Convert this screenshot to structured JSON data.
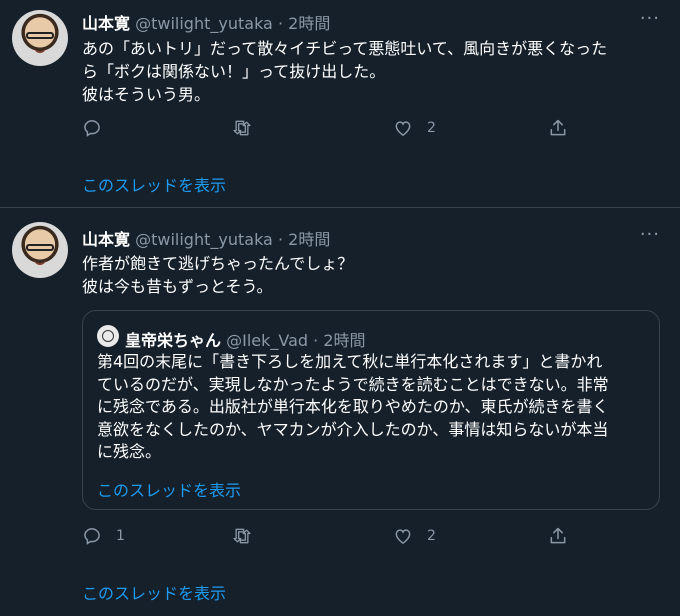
{
  "tweets": [
    {
      "name": "山本寛",
      "handle": "@twilight_yutaka",
      "dot": "·",
      "time": "2時間",
      "more": "···",
      "text": "あの「あいトリ」だって散々イチビって悪態吐いて、風向きが悪くなった\nら「ボクは関係ない！」って抜け出した。\n彼はそういう男。",
      "reply_count": "",
      "retweet_count": "",
      "like_count": "2",
      "thread_link": "このスレッドを表示"
    },
    {
      "name": "山本寛",
      "handle": "@twilight_yutaka",
      "dot": "·",
      "time": "2時間",
      "more": "···",
      "text": "作者が飽きて逃げちゃったんでしょ？\n彼は今も昔もずっとそう。",
      "quote": {
        "name": "皇帝栄ちゃん",
        "handle": "@Ilek_Vad",
        "dot": "·",
        "time": "2時間",
        "text": "第4回の末尾に「書き下ろしを加えて秋に単行本化されます」と書かれ\nているのだが、実現しなかったようで続きを読むことはできない。非常\nに残念である。出版社が単行本化を取りやめたのか、東氏が続きを書く\n意欲をなくしたのか、ヤマカンが介入したのか、事情は知らないが本当\nに残念。",
        "thread_link": "このスレッドを表示"
      },
      "reply_count": "1",
      "retweet_count": "",
      "like_count": "2",
      "thread_link": "このスレッドを表示"
    }
  ],
  "colors": {
    "background": "#15202b",
    "text": "#ffffff",
    "secondary": "#8b98a5",
    "link": "#1d9bf0",
    "border": "#38444d"
  },
  "icons": [
    "reply-icon",
    "retweet-icon",
    "like-icon",
    "share-icon",
    "more-icon"
  ]
}
